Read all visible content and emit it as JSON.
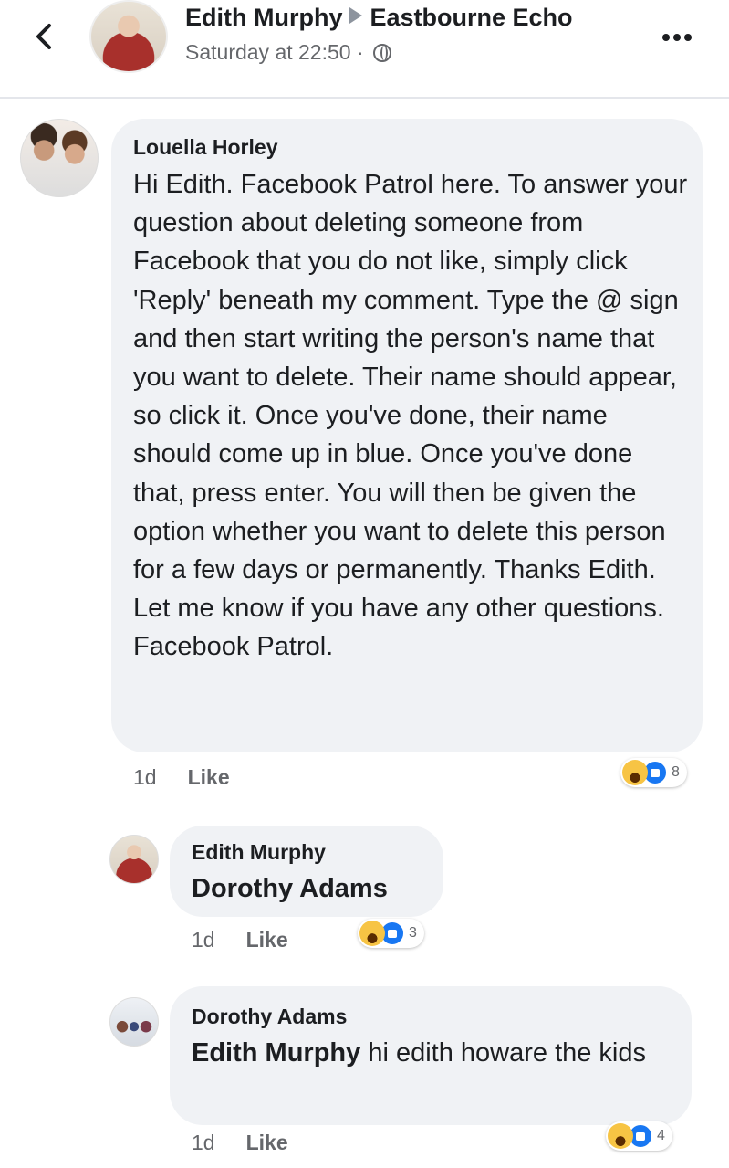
{
  "header": {
    "author": "Edith Murphy",
    "target": "Eastbourne Echo",
    "timestamp": "Saturday at 22:50",
    "separator": "·",
    "back_icon": "chevron-left-icon",
    "more_icon": "more-horizontal-icon",
    "privacy_icon": "globe-icon"
  },
  "comments": [
    {
      "author": "Louella Horley",
      "text": "Hi Edith. Facebook Patrol here. To answer your question about deleting someone from Facebook that you do not like, simply click 'Reply' beneath my comment. Type the @ sign and then start writing the person's name that you want to delete. Their name should appear, so click it. Once you've done, their name should come up in blue. Once you've done that, press enter. You will then be given the option whether you want to delete this person for a few days or permanently. Thanks Edith. Let me know if you have any other questions. Facebook Patrol.",
      "age": "1d",
      "like_label": "Like",
      "reaction_count": "8",
      "reactions": [
        "haha-icon",
        "like-icon"
      ]
    },
    {
      "author": "Edith Murphy",
      "mention": "Dorothy Adams",
      "text": "",
      "age": "1d",
      "like_label": "Like",
      "reaction_count": "3",
      "reactions": [
        "haha-icon",
        "like-icon"
      ]
    },
    {
      "author": "Dorothy Adams",
      "mention": "Edith Murphy",
      "text": " hi edith howare the kids",
      "age": "1d",
      "like_label": "Like",
      "reaction_count": "4",
      "reactions": [
        "haha-icon",
        "like-icon"
      ]
    }
  ],
  "colors": {
    "bubble": "#f0f2f5",
    "meta": "#65676b",
    "like_blue": "#1877f2",
    "haha_yellow": "#f7c444"
  }
}
